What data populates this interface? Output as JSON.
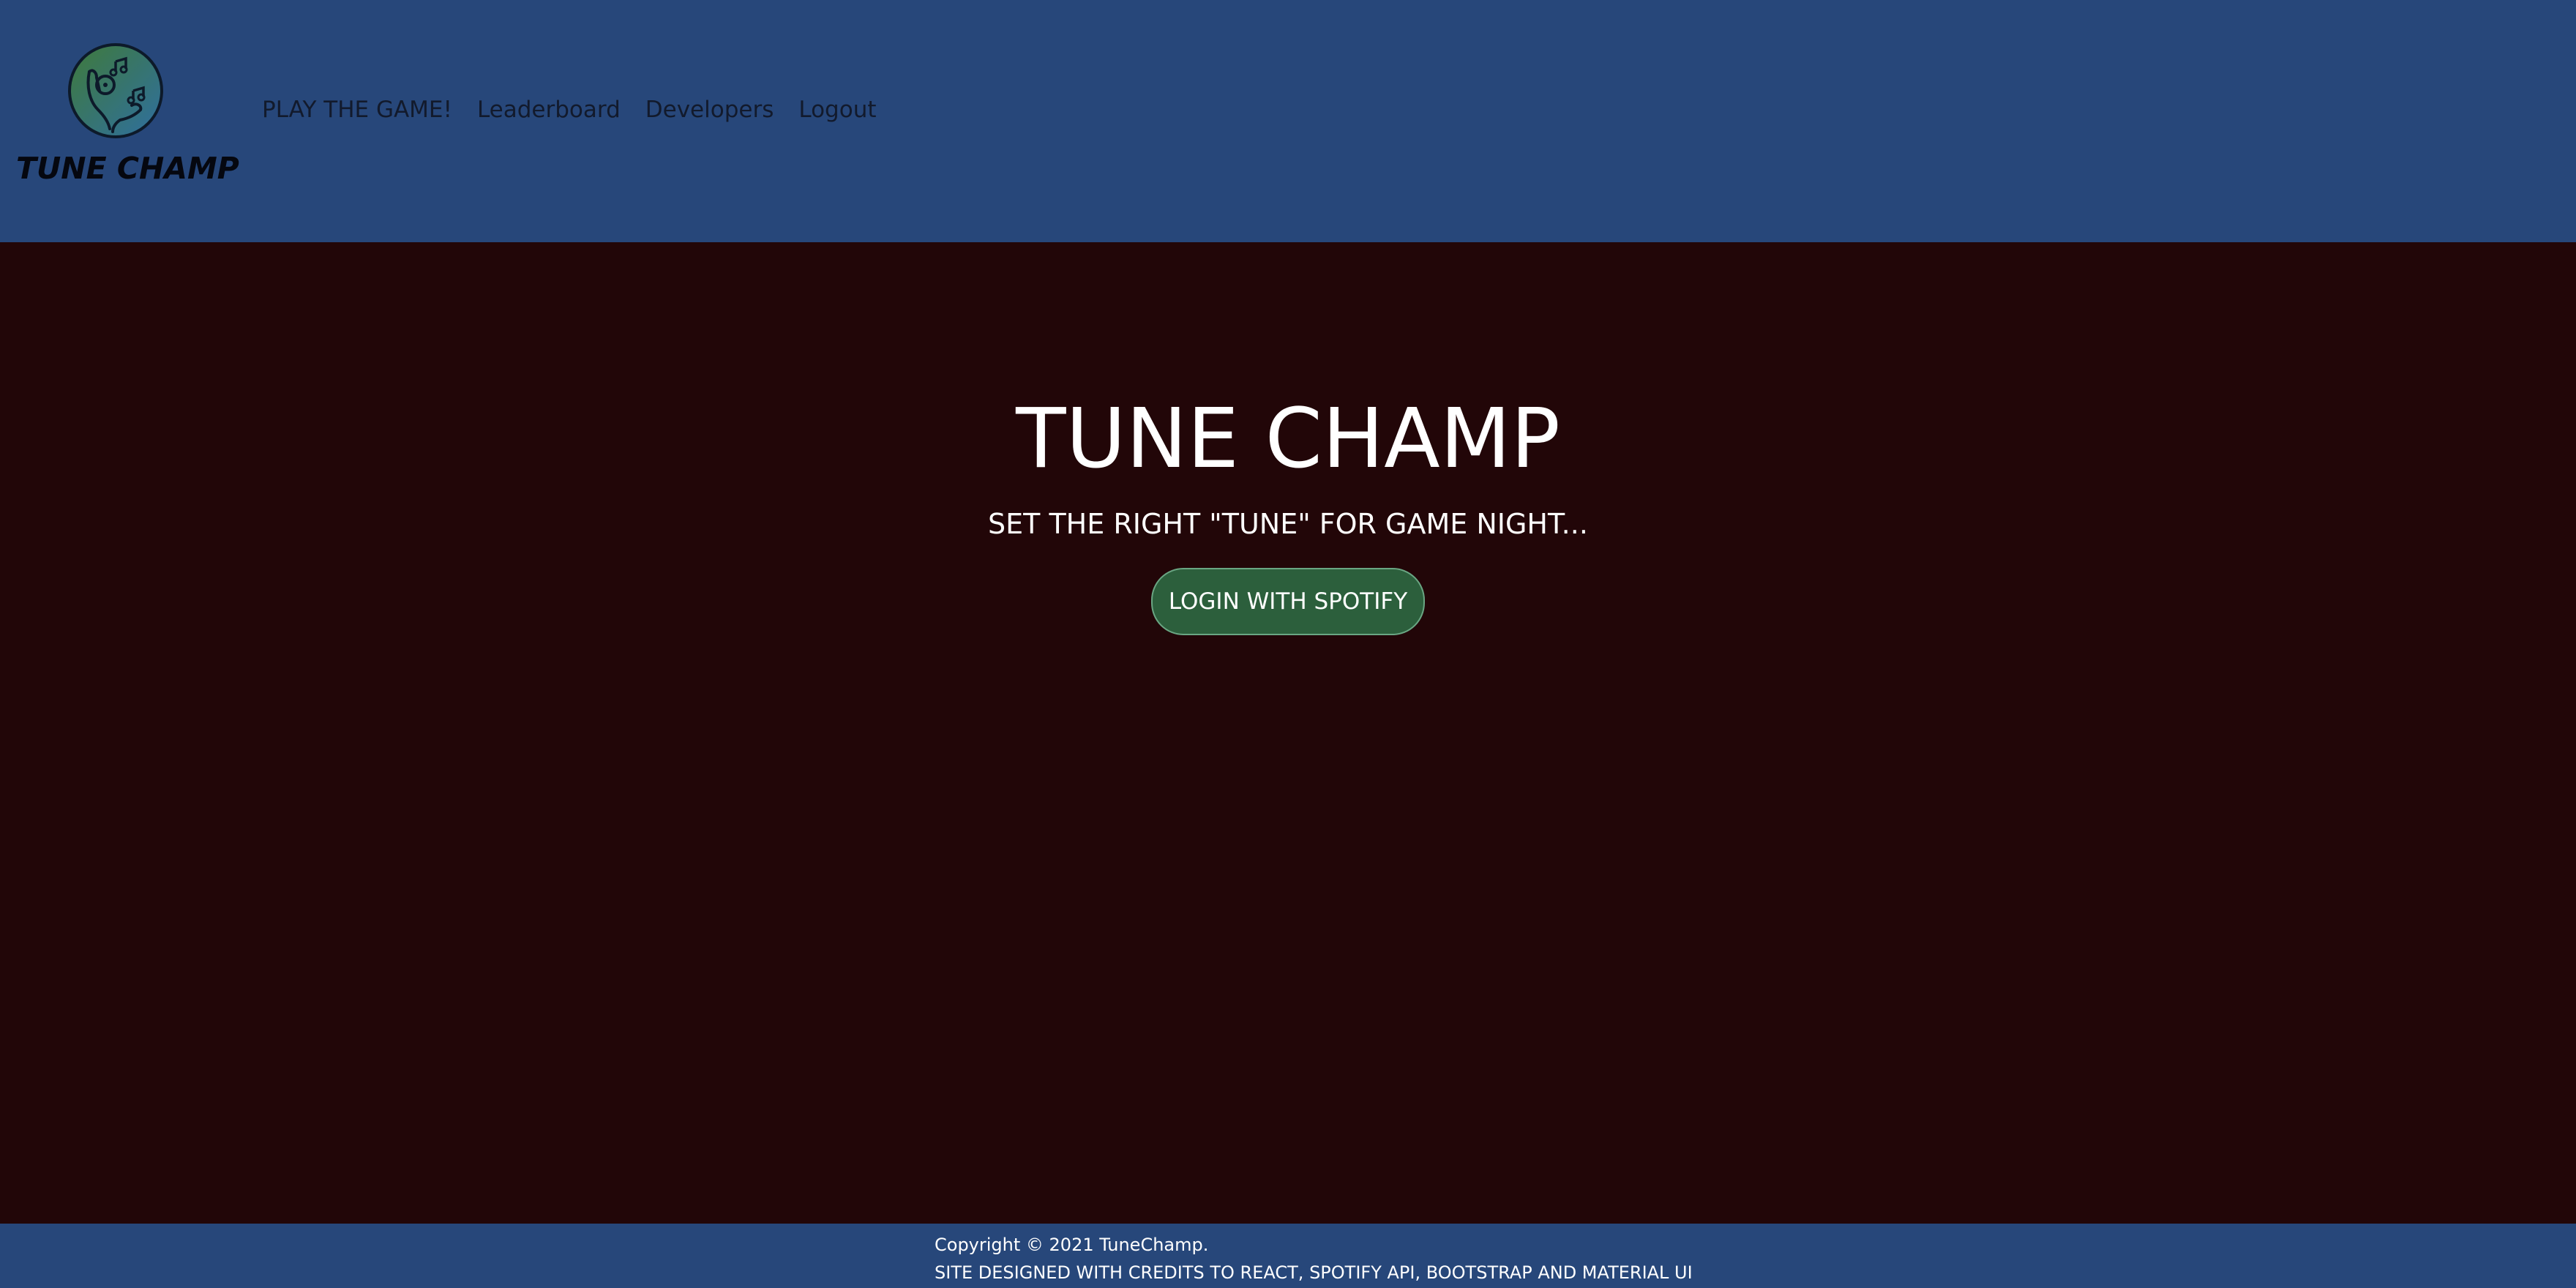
{
  "brand": {
    "logo_icon": "music-hand-icon",
    "name": "TUNE CHAMP"
  },
  "nav": {
    "items": [
      {
        "label": "PLAY THE GAME!"
      },
      {
        "label": "Leaderboard"
      },
      {
        "label": "Developers"
      },
      {
        "label": "Logout"
      }
    ]
  },
  "hero": {
    "title": "TUNE CHAMP",
    "subtitle": "SET THE RIGHT \"TUNE\" FOR GAME NIGHT...",
    "login_label": "LOGIN WITH SPOTIFY"
  },
  "footer": {
    "copyright": "Copyright © 2021 TuneChamp.",
    "credits": "SITE DESIGNED WITH CREDITS TO REACT, SPOTIFY API, BOOTSTRAP AND MATERIAL UI"
  },
  "colors": {
    "navbar_bg": "#27477a",
    "page_bg": "#220608",
    "button_bg": "#2c5f3c",
    "logo_gradient_start": "#3f7a3a",
    "logo_gradient_end": "#2f6fa0"
  }
}
